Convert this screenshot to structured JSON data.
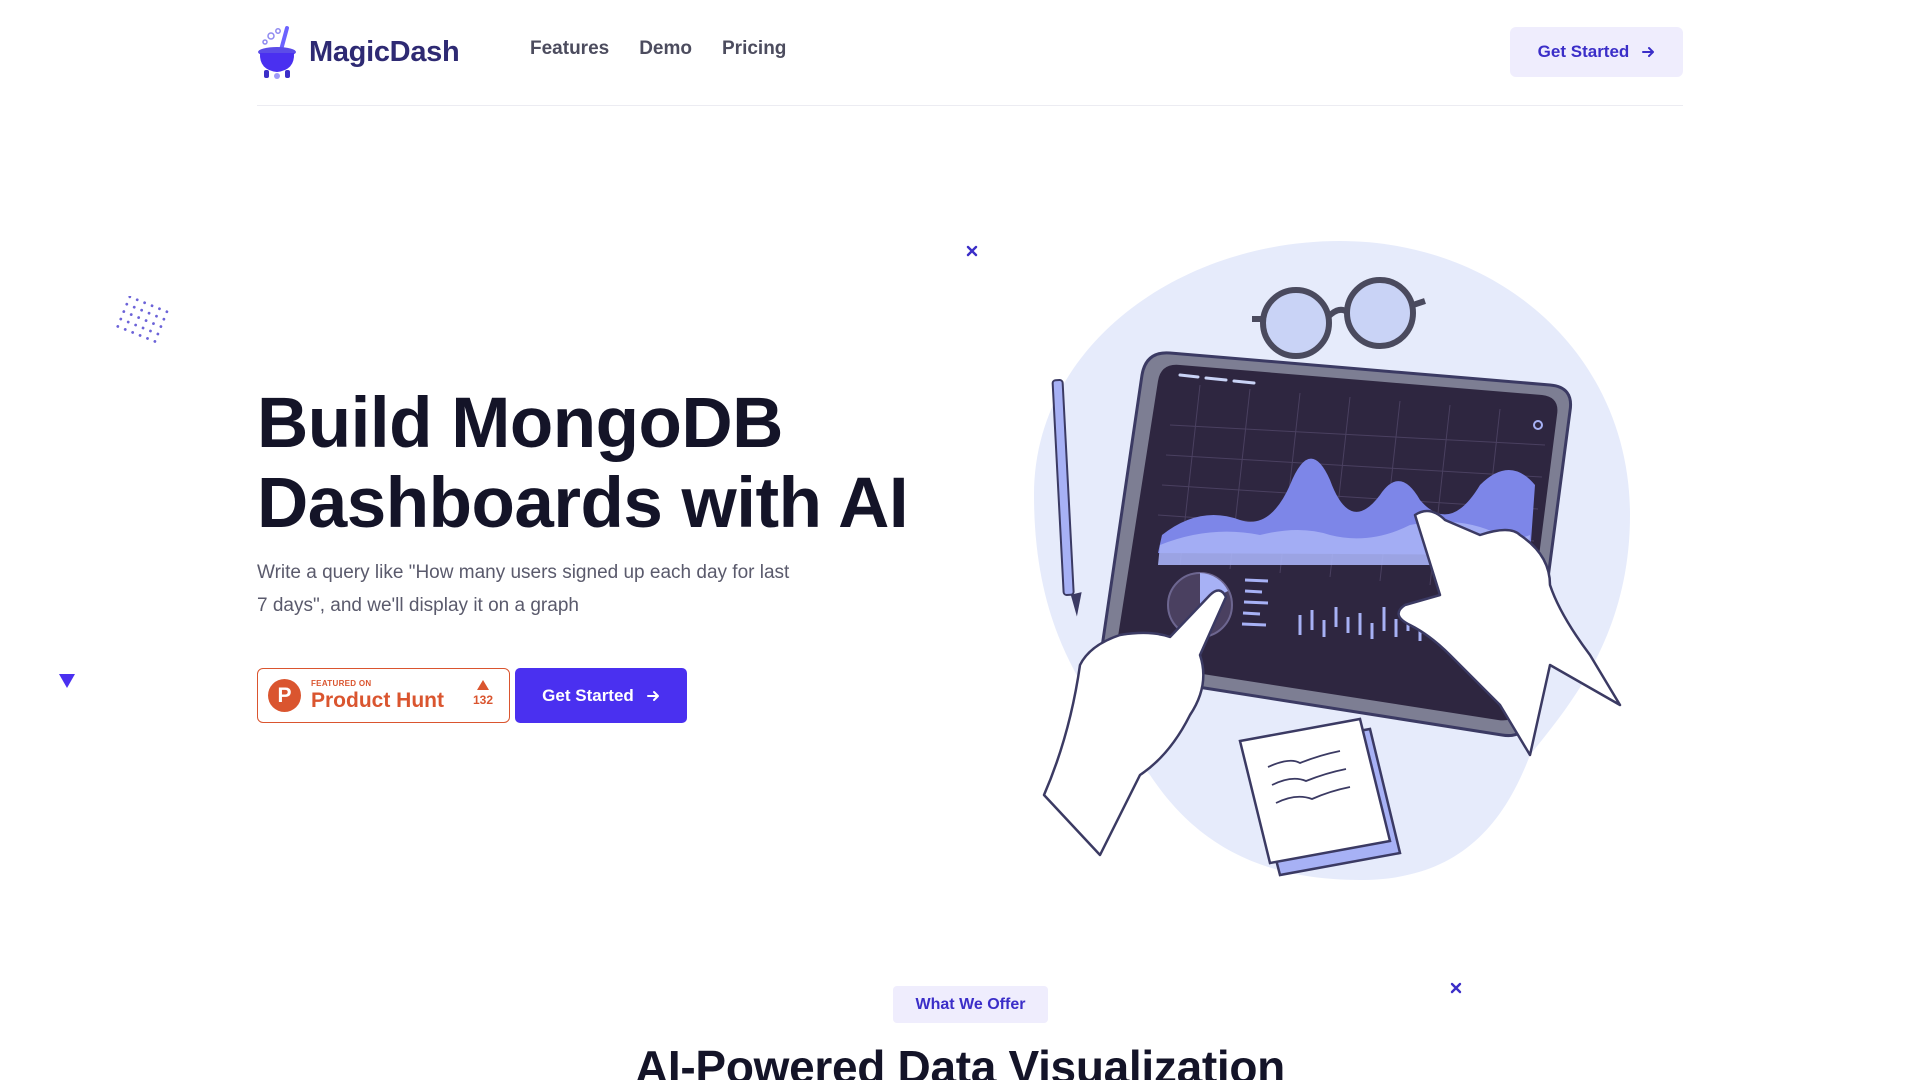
{
  "nav": {
    "brand": "MagicDash",
    "links": [
      "Features",
      "Demo",
      "Pricing"
    ],
    "cta_label": "Get Started"
  },
  "hero": {
    "title_line1": "Build MongoDB",
    "title_line2": "Dashboards with AI",
    "subtitle": "Write a query like \"How many users signed up each day for last 7 days\", and we'll display it on a graph",
    "product_hunt": {
      "featured_label": "FEATURED ON",
      "name": "Product Hunt",
      "logo_letter": "P",
      "votes": "132"
    },
    "cta_label": "Get Started"
  },
  "offer": {
    "tag": "What We Offer",
    "title": "AI-Powered Data Visualization"
  },
  "colors": {
    "brand": "#2e2a73",
    "accent": "#4a30f0",
    "accent_soft": "#efedfd",
    "product_hunt": "#da552f",
    "blob": "#e6ebfb"
  },
  "icons": {
    "nav_cta": "arrow-right-icon",
    "hero_cta": "arrow-right-icon",
    "logo": "cauldron-logo-icon"
  }
}
